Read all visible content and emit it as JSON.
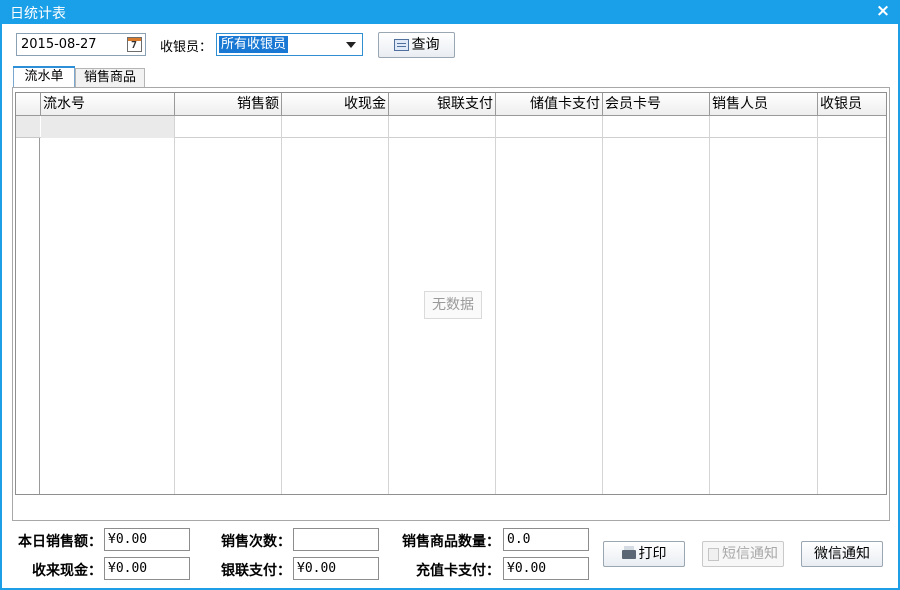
{
  "window": {
    "title": "日统计表",
    "close_label": "×"
  },
  "filters": {
    "date_value": "2015-08-27",
    "calendar_glyph": "7",
    "cashier_label": "收银员：",
    "cashier_selected": "所有收银员",
    "query_button": "查询"
  },
  "tabs": [
    {
      "label": "流水单",
      "active": true
    },
    {
      "label": "销售商品",
      "active": false
    }
  ],
  "grid": {
    "columns": [
      "流水号",
      "销售额",
      "收现金",
      "银联支付",
      "储值卡支付",
      "会员卡号",
      "销售人员",
      "收银员"
    ],
    "rows": [],
    "empty_text": "无数据"
  },
  "summary": {
    "daily_sales_label": "本日销售额：",
    "daily_sales_value": "¥0.00",
    "cash_received_label": "收来现金：",
    "cash_received_value": "¥0.00",
    "sales_count_label": "销售次数：",
    "sales_count_value": "",
    "unionpay_label": "银联支付：",
    "unionpay_value": "¥0.00",
    "item_qty_label": "销售商品数量：",
    "item_qty_value": "0.0",
    "card_pay_label": "充值卡支付：",
    "card_pay_value": "¥0.00"
  },
  "actions": {
    "print": "打印",
    "sms": "短信通知",
    "wechat": "微信通知"
  },
  "colors": {
    "title_bar": "#1aa0e8",
    "selection": "#1978d4",
    "disabled_text": "#a8a8a8"
  },
  "icons": [
    "calendar-icon",
    "query-icon",
    "printer-icon",
    "sms-icon",
    "close-icon"
  ]
}
